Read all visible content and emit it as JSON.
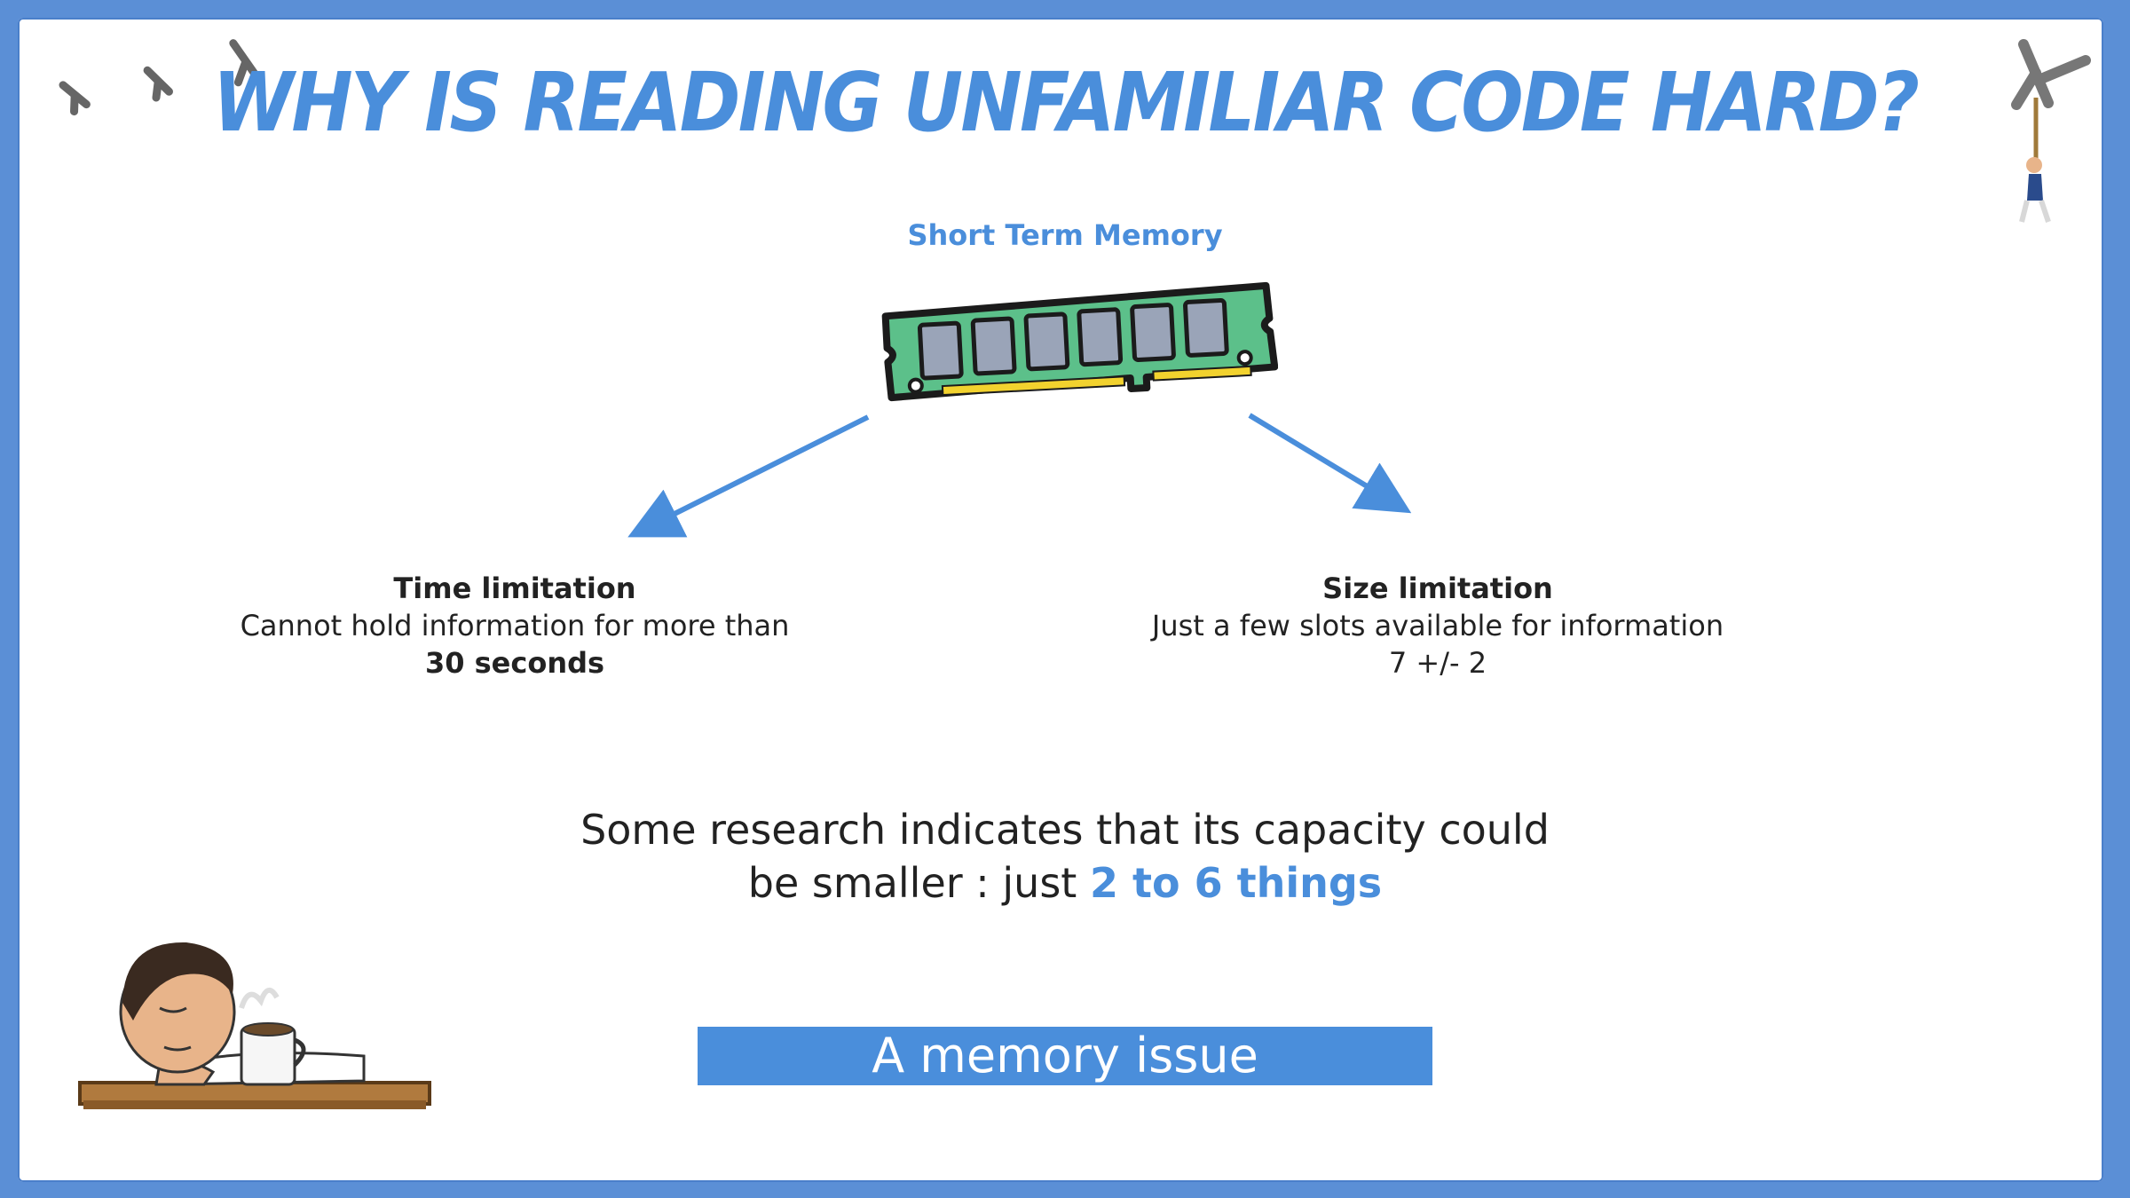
{
  "slide": {
    "title": "Why is reading unfamiliar code hard?",
    "caption": "Short Term Memory",
    "time_limit": {
      "heading": "Time limitation",
      "text": "Cannot hold information for more than",
      "value": "30 seconds"
    },
    "size_limit": {
      "heading": "Size limitation",
      "text": "Just a few slots available for information",
      "value": "7 +/- 2"
    },
    "research": {
      "line1": "Some research indicates that its capacity could",
      "line2_prefix": "be smaller : just ",
      "line2_highlight": "2 to 6 things"
    },
    "banner": "A memory issue"
  },
  "colors": {
    "accent": "#4a8edb",
    "frame": "#5b8fd6",
    "text": "#222222",
    "ram_board": "#5cc08a",
    "ram_chip": "#9aa4b8",
    "ram_pins": "#f2d22e"
  },
  "icons": [
    "lambda-icon",
    "ram-module-icon",
    "rope-climber-illustration",
    "sleeping-person-illustration",
    "coffee-mug-icon"
  ]
}
